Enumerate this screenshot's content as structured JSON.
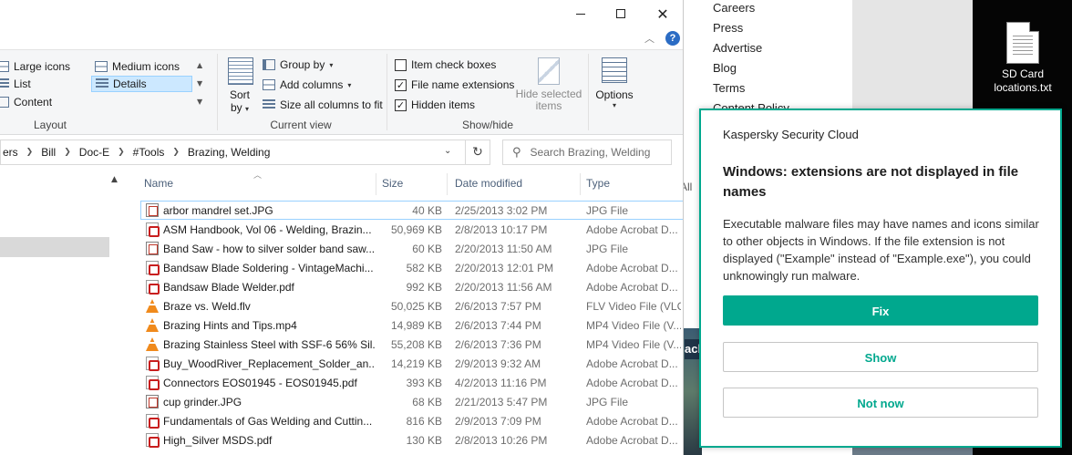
{
  "explorer": {
    "ribbon": {
      "layout": {
        "large_icons": "Large icons",
        "medium_icons": "Medium icons",
        "list": "List",
        "details": "Details",
        "content": "Content",
        "group_label": "Layout"
      },
      "current_view": {
        "sort_by": "Sort",
        "sort_by_2": "by",
        "group_by": "Group by",
        "add_columns": "Add columns",
        "size_all_columns": "Size all columns to fit",
        "group_label": "Current view"
      },
      "show_hide": {
        "item_check_boxes": "Item check boxes",
        "item_check_boxes_checked": false,
        "file_name_extensions": "File name extensions",
        "file_name_extensions_checked": true,
        "hidden_items": "Hidden items",
        "hidden_items_checked": true,
        "hide_selected_items_1": "Hide selected",
        "hide_selected_items_2": "items",
        "group_label": "Show/hide"
      },
      "options": "Options",
      "help": "?"
    },
    "address": {
      "crumbs": [
        "ers",
        "Bill",
        "Doc-E",
        "#Tools",
        "Brazing, Welding"
      ]
    },
    "search": {
      "placeholder": "Search Brazing, Welding"
    },
    "columns": {
      "name": "Name",
      "size": "Size",
      "date_modified": "Date modified",
      "type": "Type"
    },
    "files": [
      {
        "name": "arbor mandrel set.JPG",
        "size": "40 KB",
        "date": "2/25/2013 3:02 PM",
        "type": "JPG File",
        "icon": "jpg-icon"
      },
      {
        "name": "ASM Handbook, Vol 06 - Welding, Brazin...",
        "size": "50,969 KB",
        "date": "2/8/2013 10:17 PM",
        "type": "Adobe Acrobat D...",
        "icon": "pdf-icon"
      },
      {
        "name": "Band Saw - how to silver solder band saw...",
        "size": "60 KB",
        "date": "2/20/2013 11:50 AM",
        "type": "JPG File",
        "icon": "jpg-icon"
      },
      {
        "name": "Bandsaw Blade Soldering - VintageMachi...",
        "size": "582 KB",
        "date": "2/20/2013 12:01 PM",
        "type": "Adobe Acrobat D...",
        "icon": "pdf-icon"
      },
      {
        "name": "Bandsaw Blade Welder.pdf",
        "size": "992 KB",
        "date": "2/20/2013 11:56 AM",
        "type": "Adobe Acrobat D...",
        "icon": "pdf-icon"
      },
      {
        "name": "Braze vs. Weld.flv",
        "size": "50,025 KB",
        "date": "2/6/2013 7:57 PM",
        "type": "FLV Video File (VLC)",
        "icon": "vlc-icon"
      },
      {
        "name": "Brazing Hints and Tips.mp4",
        "size": "14,989 KB",
        "date": "2/6/2013 7:44 PM",
        "type": "MP4 Video File (V...",
        "icon": "vlc-icon"
      },
      {
        "name": "Brazing Stainless Steel with SSF-6 56% Sil...",
        "size": "55,208 KB",
        "date": "2/6/2013 7:36 PM",
        "type": "MP4 Video File (V...",
        "icon": "vlc-icon"
      },
      {
        "name": "Buy_WoodRiver_Replacement_Solder_an...",
        "size": "14,219 KB",
        "date": "2/9/2013 9:32 AM",
        "type": "Adobe Acrobat D...",
        "icon": "pdf-icon"
      },
      {
        "name": "Connectors EOS01945 - EOS01945.pdf",
        "size": "393 KB",
        "date": "4/2/2013 11:16 PM",
        "type": "Adobe Acrobat D...",
        "icon": "pdf-icon"
      },
      {
        "name": "cup grinder.JPG",
        "size": "68 KB",
        "date": "2/21/2013 5:47 PM",
        "type": "JPG File",
        "icon": "jpg-icon"
      },
      {
        "name": "Fundamentals of Gas Welding and Cuttin...",
        "size": "816 KB",
        "date": "2/9/2013 7:09 PM",
        "type": "Adobe Acrobat D...",
        "icon": "pdf-icon"
      },
      {
        "name": "High_Silver MSDS.pdf",
        "size": "130 KB",
        "date": "2/8/2013 10:26 PM",
        "type": "Adobe Acrobat D...",
        "icon": "pdf-icon"
      }
    ]
  },
  "background": {
    "links": [
      "Careers",
      "Press",
      "Advertise",
      "Blog",
      "Terms",
      "Content Policy"
    ],
    "desktop_file": "SD Card locations.txt",
    "frag_1": "All r",
    "frag_2": "ack"
  },
  "kaspersky": {
    "brand": "Kaspersky Security Cloud",
    "title": "Windows: extensions are not displayed in file names",
    "body": "Executable malware files may have names and icons similar to other objects in Windows. If the file extension is not displayed (\"Example\" instead of \"Example.exe\"), you could unknowingly run malware.",
    "fix": "Fix",
    "show": "Show",
    "not_now": "Not now",
    "accent": "#00a88e"
  }
}
